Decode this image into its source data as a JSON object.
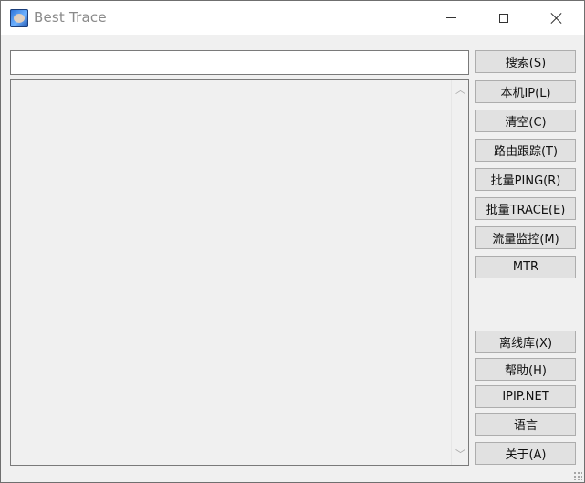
{
  "window": {
    "title": "Best Trace",
    "icon": "besttrace-app-icon"
  },
  "search": {
    "value": "",
    "placeholder": ""
  },
  "output": {
    "text": ""
  },
  "buttons": {
    "search": "搜索(S)",
    "local_ip": "本机IP(L)",
    "clear": "清空(C)",
    "route_trace": "路由跟踪(T)",
    "batch_ping": "批量PING(R)",
    "batch_trace": "批量TRACE(E)",
    "traffic_monitor": "流量监控(M)",
    "mtr": "MTR",
    "offline_db": "离线库(X)",
    "help": "帮助(H)",
    "ipip_net": "IPIP.NET",
    "language": "语言",
    "about": "关于(A)"
  },
  "colors": {
    "window_bg": "#f0f0f0",
    "button_bg": "#e1e1e1",
    "button_border": "#adadad",
    "title_text": "#8a8a8a"
  }
}
